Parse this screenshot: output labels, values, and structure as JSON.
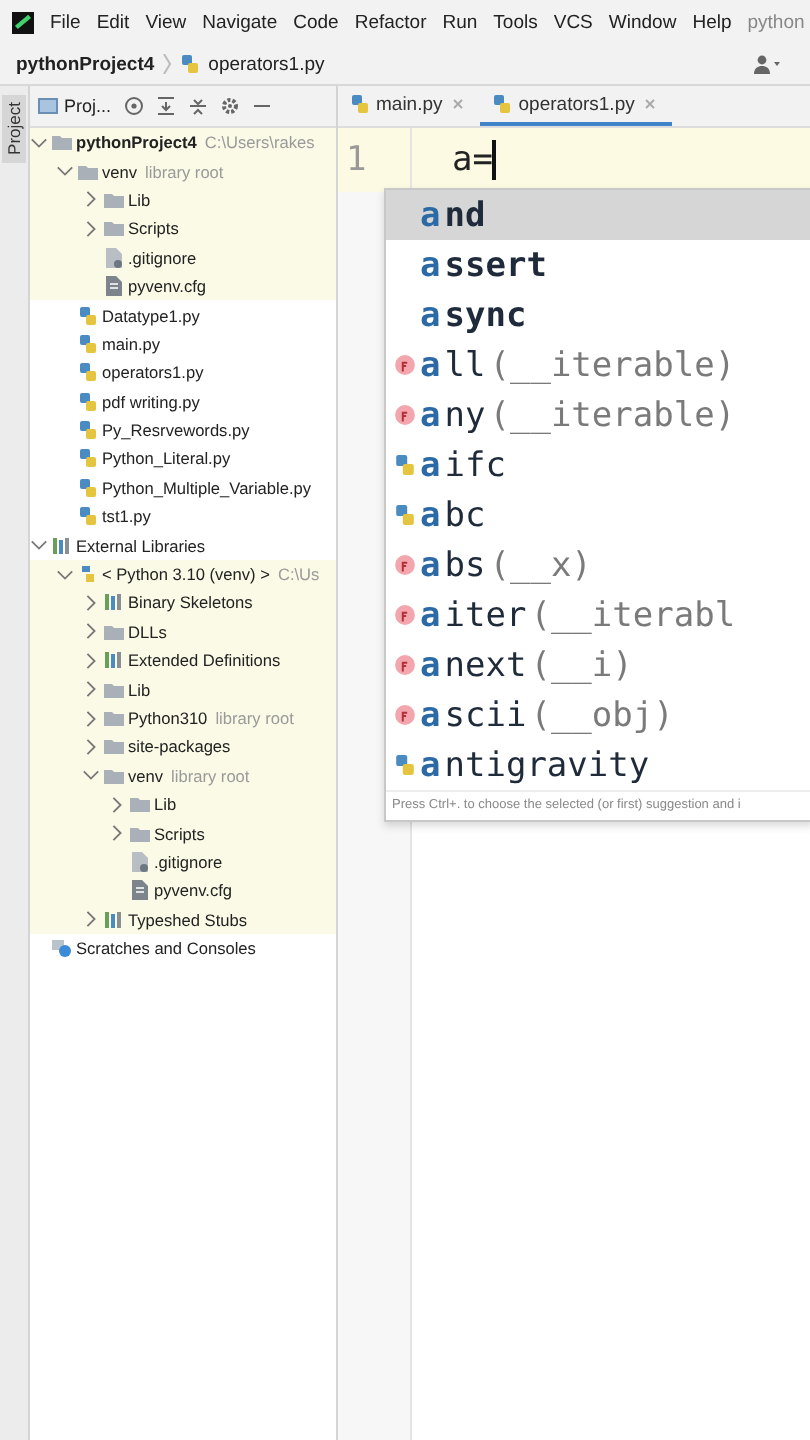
{
  "menu": [
    "File",
    "Edit",
    "View",
    "Navigate",
    "Code",
    "Refactor",
    "Run",
    "Tools",
    "VCS",
    "Window",
    "Help",
    "python"
  ],
  "breadcrumb": {
    "project": "pythonProject4",
    "file": "operators1.py"
  },
  "side_tab": "Project",
  "panel_header": {
    "title": "Proj..."
  },
  "editor_tabs": [
    {
      "label": "main.py",
      "selected": false
    },
    {
      "label": "operators1.py",
      "selected": true
    }
  ],
  "tree": [
    {
      "label": "pythonProject4",
      "hint": "C:\\Users\\rakes",
      "kind": "folder",
      "bold": true,
      "expanded": true,
      "highlighted": true,
      "children": [
        {
          "label": "venv",
          "hint": "library root",
          "kind": "folder",
          "expanded": true,
          "highlighted": true,
          "children": [
            {
              "label": "Lib",
              "kind": "folder",
              "expanded": false,
              "highlighted": true
            },
            {
              "label": "Scripts",
              "kind": "folder",
              "expanded": false,
              "highlighted": true
            },
            {
              "label": ".gitignore",
              "kind": "ignore",
              "highlighted": true
            },
            {
              "label": "pyvenv.cfg",
              "kind": "config",
              "highlighted": true
            }
          ]
        },
        {
          "label": "Datatype1.py",
          "kind": "python",
          "highlighted": false
        },
        {
          "label": "main.py",
          "kind": "python",
          "highlighted": false
        },
        {
          "label": "operators1.py",
          "kind": "python",
          "highlighted": false
        },
        {
          "label": "pdf writing.py",
          "kind": "python",
          "highlighted": false
        },
        {
          "label": "Py_Resrvewords.py",
          "kind": "python",
          "highlighted": false
        },
        {
          "label": "Python_Literal.py",
          "kind": "python",
          "highlighted": false
        },
        {
          "label": "Python_Multiple_Variable.py",
          "kind": "python",
          "highlighted": false
        },
        {
          "label": "tst1.py",
          "kind": "python",
          "highlighted": false
        }
      ]
    },
    {
      "label": "External Libraries",
      "kind": "library",
      "expanded": true,
      "highlighted": false,
      "children": [
        {
          "label": "< Python 3.10 (venv) >",
          "hint": "C:\\Us",
          "kind": "sdk",
          "expanded": true,
          "highlighted": true,
          "children": [
            {
              "label": "Binary Skeletons",
              "kind": "library",
              "expanded": false,
              "highlighted": true
            },
            {
              "label": "DLLs",
              "kind": "folder",
              "expanded": false,
              "highlighted": true
            },
            {
              "label": "Extended Definitions",
              "kind": "library",
              "expanded": false,
              "highlighted": true
            },
            {
              "label": "Lib",
              "kind": "folder",
              "expanded": false,
              "highlighted": true
            },
            {
              "label": "Python310",
              "hint": "library root",
              "kind": "folder",
              "expanded": false,
              "highlighted": true
            },
            {
              "label": "site-packages",
              "kind": "folder",
              "expanded": false,
              "highlighted": true
            },
            {
              "label": "venv",
              "hint": "library root",
              "kind": "folder",
              "expanded": true,
              "highlighted": true,
              "children": [
                {
                  "label": "Lib",
                  "kind": "folder",
                  "expanded": false,
                  "highlighted": true
                },
                {
                  "label": "Scripts",
                  "kind": "folder",
                  "expanded": false,
                  "highlighted": true
                },
                {
                  "label": ".gitignore",
                  "kind": "ignore",
                  "highlighted": true
                },
                {
                  "label": "pyvenv.cfg",
                  "kind": "config",
                  "highlighted": true
                }
              ]
            },
            {
              "label": "Typeshed Stubs",
              "kind": "library",
              "expanded": false,
              "highlighted": true
            }
          ]
        }
      ]
    },
    {
      "label": "Scratches and Consoles",
      "kind": "scratches",
      "highlighted": false
    }
  ],
  "editor": {
    "line_number": "1",
    "code": "a="
  },
  "completion": {
    "items": [
      {
        "kind": "keyword",
        "match": "a",
        "rest": "nd",
        "selected": true
      },
      {
        "kind": "keyword",
        "match": "a",
        "rest": "ssert",
        "selected": false
      },
      {
        "kind": "keyword",
        "match": "a",
        "rest": "sync",
        "selected": false
      },
      {
        "kind": "function",
        "match": "a",
        "rest": "ll",
        "params": "(__iterable)",
        "selected": false
      },
      {
        "kind": "function",
        "match": "a",
        "rest": "ny",
        "params": "(__iterable)",
        "selected": false
      },
      {
        "kind": "module",
        "match": "a",
        "rest": "ifc",
        "selected": false
      },
      {
        "kind": "module",
        "match": "a",
        "rest": "bc",
        "selected": false
      },
      {
        "kind": "function",
        "match": "a",
        "rest": "bs",
        "params": "(__x)",
        "selected": false
      },
      {
        "kind": "function",
        "match": "a",
        "rest": "iter",
        "params": "(__iterabl",
        "selected": false
      },
      {
        "kind": "function",
        "match": "a",
        "rest": "next",
        "params": "(__i)",
        "selected": false
      },
      {
        "kind": "function",
        "match": "a",
        "rest": "scii",
        "params": "(__obj)",
        "selected": false
      },
      {
        "kind": "module",
        "match": "a",
        "rest": "ntigravity",
        "selected": false
      }
    ],
    "hint": "Press Ctrl+. to choose the selected (or first) suggestion and i"
  }
}
